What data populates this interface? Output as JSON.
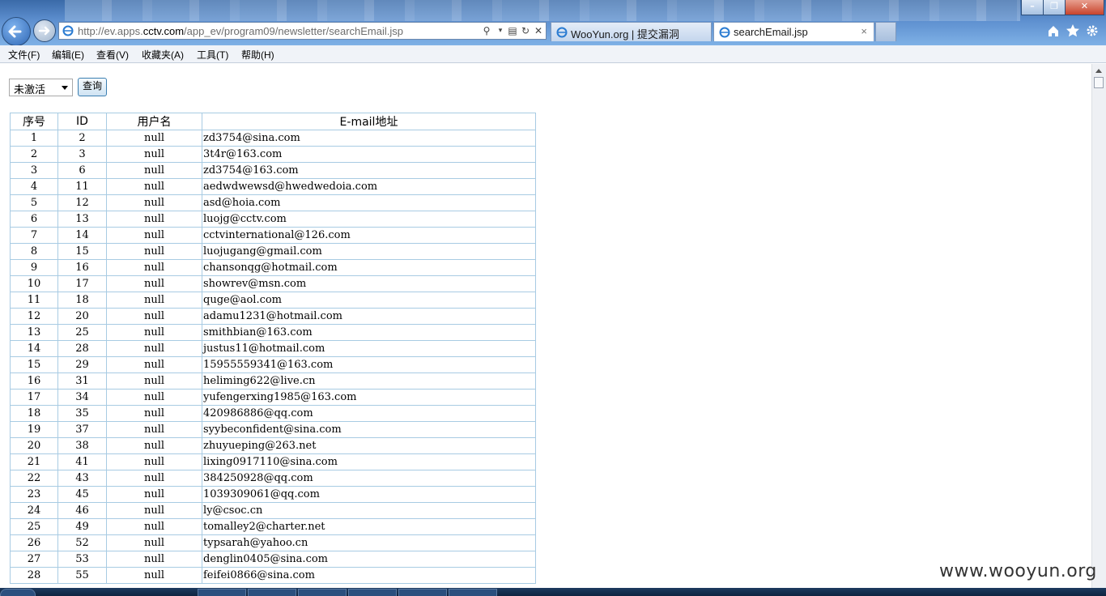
{
  "browser": {
    "address": {
      "prefix": "http://ev.apps.",
      "domain": "cctv.com",
      "path": "/app_ev/program09/newsletter/searchEmail.jsp"
    },
    "tabs": [
      {
        "label": "WooYun.org | 提交漏洞",
        "icon": "ie-page-icon"
      },
      {
        "label": "searchEmail.jsp",
        "icon": "ie-page-icon",
        "close": "×"
      }
    ],
    "window_controls": {
      "minimize": "–",
      "maximize": "❐",
      "close": "✕"
    }
  },
  "menu": {
    "items": [
      "文件(F)",
      "编辑(E)",
      "查看(V)",
      "收藏夹(A)",
      "工具(T)",
      "帮助(H)"
    ]
  },
  "filter": {
    "selected": "未激活"
  },
  "query_button": "查询",
  "table": {
    "headers": [
      "序号",
      "ID",
      "用户名",
      "E-mail地址"
    ],
    "rows": [
      [
        "1",
        "2",
        "null",
        "zd3754@sina.com"
      ],
      [
        "2",
        "3",
        "null",
        "3t4r@163.com"
      ],
      [
        "3",
        "6",
        "null",
        "zd3754@163.com"
      ],
      [
        "4",
        "11",
        "null",
        "aedwdwewsd@hwedwedoia.com"
      ],
      [
        "5",
        "12",
        "null",
        "asd@hoia.com"
      ],
      [
        "6",
        "13",
        "null",
        "luojg@cctv.com"
      ],
      [
        "7",
        "14",
        "null",
        "cctvinternational@126.com"
      ],
      [
        "8",
        "15",
        "null",
        "luojugang@gmail.com"
      ],
      [
        "9",
        "16",
        "null",
        "chansonqg@hotmail.com"
      ],
      [
        "10",
        "17",
        "null",
        "showrev@msn.com"
      ],
      [
        "11",
        "18",
        "null",
        "quge@aol.com"
      ],
      [
        "12",
        "20",
        "null",
        "adamu1231@hotmail.com"
      ],
      [
        "13",
        "25",
        "null",
        "smithbian@163.com"
      ],
      [
        "14",
        "28",
        "null",
        "justus11@hotmail.com"
      ],
      [
        "15",
        "29",
        "null",
        "15955559341@163.com"
      ],
      [
        "16",
        "31",
        "null",
        "heliming622@live.cn"
      ],
      [
        "17",
        "34",
        "null",
        "yufengerxing1985@163.com"
      ],
      [
        "18",
        "35",
        "null",
        "420986886@qq.com"
      ],
      [
        "19",
        "37",
        "null",
        "syybeconfident@sina.com"
      ],
      [
        "20",
        "38",
        "null",
        "zhuyueping@263.net"
      ],
      [
        "21",
        "41",
        "null",
        "lixing0917110@sina.com"
      ],
      [
        "22",
        "43",
        "null",
        "384250928@qq.com"
      ],
      [
        "23",
        "45",
        "null",
        "1039309061@qq.com"
      ],
      [
        "24",
        "46",
        "null",
        "ly@csoc.cn"
      ],
      [
        "25",
        "49",
        "null",
        "tomalley2@charter.net"
      ],
      [
        "26",
        "52",
        "null",
        "typsarah@yahoo.cn"
      ],
      [
        "27",
        "53",
        "null",
        "denglin0405@sina.com"
      ],
      [
        "28",
        "55",
        "null",
        "feifei0866@sina.com"
      ]
    ]
  },
  "watermark": "www.wooyun.org",
  "colors": {
    "table_border": "#a8cbe3",
    "chrome_blue": "#5d8fcf",
    "accent": "#2f67b4"
  }
}
